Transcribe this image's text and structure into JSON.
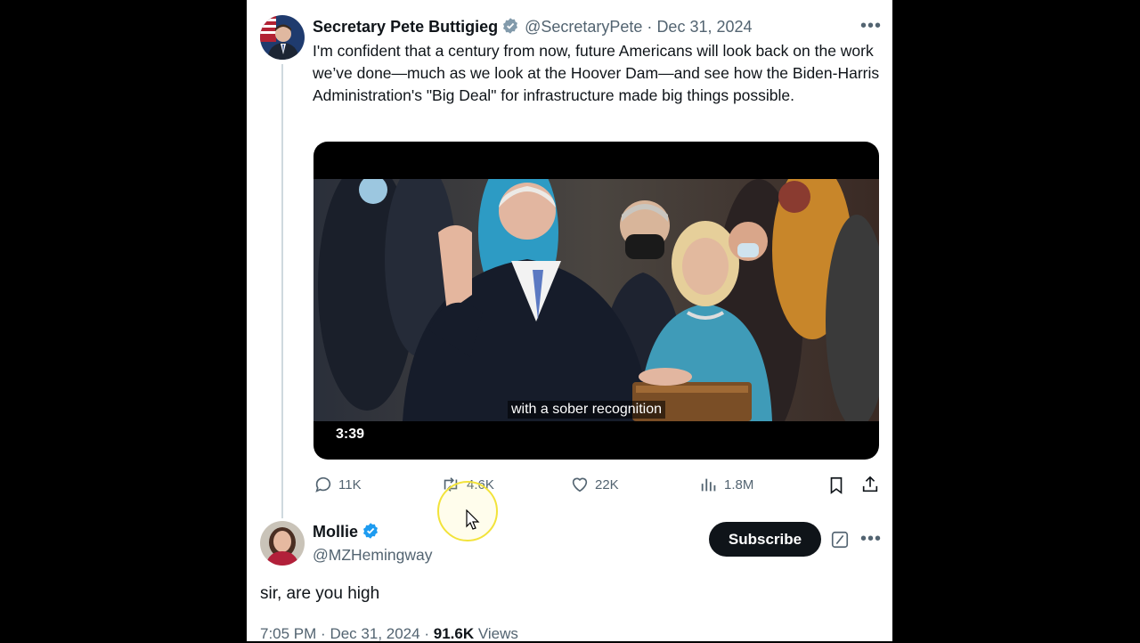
{
  "tweet": {
    "author_name": "Secretary Pete Buttigieg",
    "handle": "@SecretaryPete",
    "separator": "·",
    "date": "Dec 31, 2024",
    "more_icon": "more-horizontal-icon",
    "text": "I'm confident that a century from now, future Americans will look back on the work we’ve done—much as we look at the Hoover Dam—and see how the Biden-Harris Administration's \"Big Deal\" for infrastructure made big things possible.",
    "media": {
      "caption": "with a sober recognition",
      "duration": "3:39"
    },
    "actions": {
      "replies": "11K",
      "reposts": "4.6K",
      "likes": "22K",
      "views": "1.8M"
    }
  },
  "reply": {
    "author_name": "Mollie",
    "handle": "@MZHemingway",
    "subscribe_label": "Subscribe",
    "text": "sir, are you high",
    "time": "7:05 PM",
    "separator": "·",
    "date": "Dec 31, 2024",
    "separator2": "·",
    "views_count": "91.6K",
    "views_label": "Views"
  },
  "colors": {
    "verified_gray": "#829aab",
    "verified_blue": "#1d9bf0",
    "text": "#0f1419",
    "muted": "#536471"
  }
}
